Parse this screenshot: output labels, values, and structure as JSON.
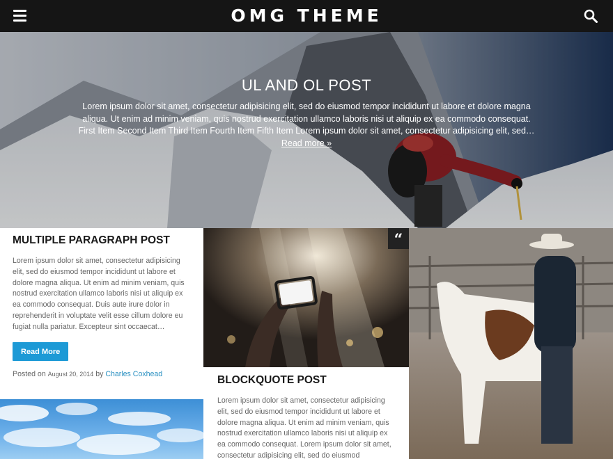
{
  "header": {
    "site_title": "OMG THEME",
    "menu_icon": "hamburger-menu-icon",
    "search_icon": "magnifier-search-icon"
  },
  "hero": {
    "title": "UL AND OL POST",
    "excerpt": "Lorem ipsum dolor sit amet, consectetur adipisicing elit, sed do eiusmod tempor incididunt ut labore et dolore magna aliqua. Ut enim ad minim veniam, quis nostrud exercitation ullamco laboris nisi ut aliquip ex ea commodo consequat. First Item Second Item Third Item Fourth Item Fifth Item Lorem ipsum dolor sit amet, consectetur adipisicing elit, sed…",
    "read_more": "Read more »"
  },
  "posts": [
    {
      "title": "MULTIPLE PARAGRAPH POST",
      "excerpt": "Lorem ipsum dolor sit amet, consectetur adipisicing elit, sed do eiusmod tempor incididunt ut labore et dolore magna aliqua. Ut enim ad minim veniam, quis nostrud exercitation ullamco laboris nisi ut aliquip ex ea commodo consequat. Duis aute irure dolor in reprehenderit in voluptate velit esse cillum dolore eu fugiat nulla pariatur. Excepteur sint occaecat…",
      "button": "Read More",
      "posted_on": "Posted on",
      "date": "August 20, 2014",
      "by": "by",
      "author": "Charles Coxhead"
    },
    {
      "title": "BLOCKQUOTE POST",
      "excerpt": "Lorem ipsum dolor sit amet, consectetur adipisicing elit, sed do eiusmod tempor incididunt ut labore et dolore magna aliqua. Ut enim ad minim veniam, quis nostrud exercitation ullamco laboris nisi ut aliquip ex ea commodo consequat. Lorem ipsum dolor sit amet, consectetur adipisicing elit, sed do eiusmod",
      "format_badge": "“",
      "format_icon": "quote-format-icon"
    }
  ],
  "colors": {
    "header_bg": "#151515",
    "accent": "#1d9ad6",
    "link": "#2b91c2"
  }
}
